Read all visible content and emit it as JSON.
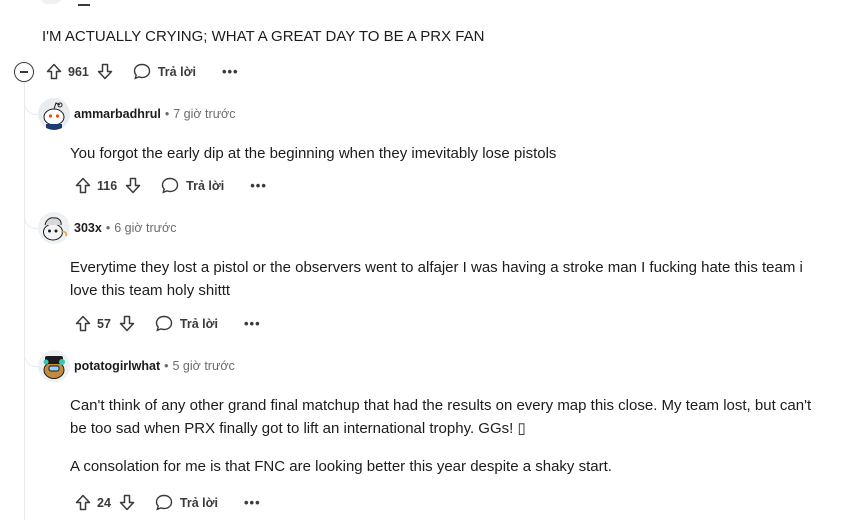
{
  "parent": {
    "text": "I'M ACTUALLY CRYING; WHAT A GREAT DAY TO BE A PRX FAN",
    "votes": "961",
    "reply_label": "Trả lời",
    "more_label": "•••"
  },
  "comments": [
    {
      "username": "ammarbadhrul",
      "time": "7 giờ trước",
      "body": [
        "You forgot the early dip at the beginning when they imevitably lose pistols"
      ],
      "votes": "116",
      "reply_label": "Trả lời",
      "more_label": "•••"
    },
    {
      "username": "303x",
      "time": "6 giờ trước",
      "body": [
        "Everytime they lost a pistol or the observers went to alfajer I was having a stroke man I fucking hate this team i love this team holy shittt"
      ],
      "votes": "57",
      "reply_label": "Trả lời",
      "more_label": "•••"
    },
    {
      "username": "potatogirlwhat",
      "time": "5 giờ trước",
      "body": [
        "Can't think of any other grand final matchup that had the results on every map this close. My team lost, but can't be too sad when PRX finally got to lift an international trophy. GGs! ▯",
        "A consolation for me is that FNC are looking better this year despite a shaky start."
      ],
      "votes": "24",
      "reply_label": "Trả lời",
      "more_label": "•••"
    }
  ],
  "separator": "•",
  "icons": {
    "upvote": "upvote-arrow-icon",
    "downvote": "downvote-arrow-icon",
    "reply": "speech-bubble-icon",
    "collapse": "collapse-minus-icon"
  }
}
